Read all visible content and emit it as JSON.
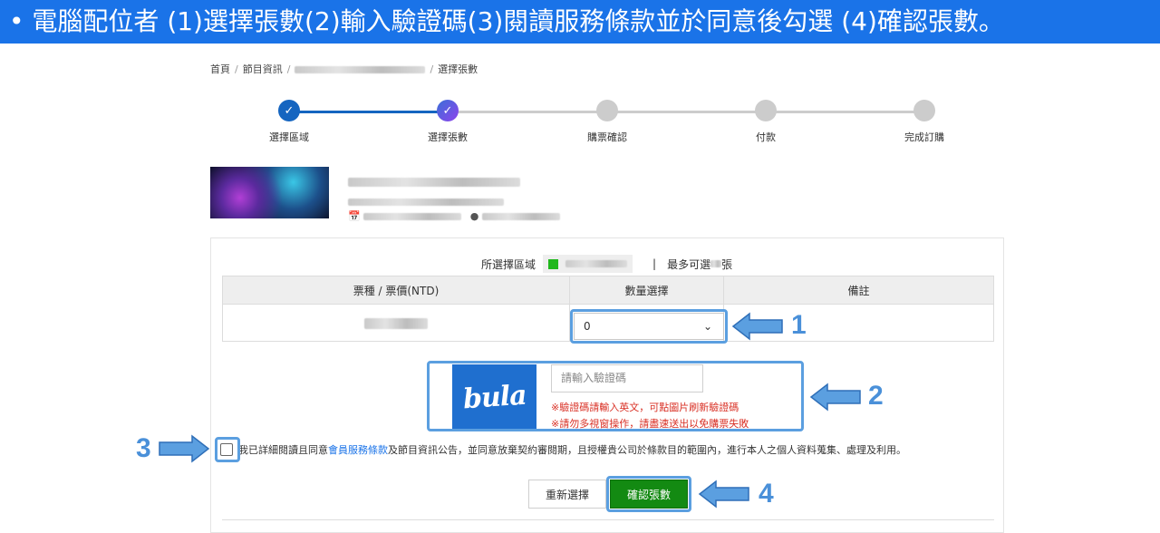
{
  "banner": {
    "text": "• 電腦配位者 (1)選擇張數(2)輸入驗證碼(3)閱讀服務條款並於同意後勾選 (4)確認張數。"
  },
  "breadcrumb": {
    "home": "首頁",
    "program": "節目資訊",
    "current": "選擇張數"
  },
  "steps": [
    {
      "label": "選擇區域",
      "state": "done"
    },
    {
      "label": "選擇張數",
      "state": "active"
    },
    {
      "label": "購票確認",
      "state": "pending"
    },
    {
      "label": "付款",
      "state": "pending"
    },
    {
      "label": "完成訂購",
      "state": "pending"
    }
  ],
  "selection": {
    "area_label": "所選擇區域",
    "separator": "|",
    "max_prefix": "最多可選",
    "max_suffix": "張"
  },
  "table": {
    "headers": [
      "票種 / 票價(NTD)",
      "數量選擇",
      "備註"
    ],
    "quantity_value": "0"
  },
  "captcha": {
    "image_text": "bula",
    "placeholder": "請輸入驗證碼",
    "warning1": "※驗證碼請輸入英文，可點圖片刷新驗證碼",
    "warning2": "※請勿多視窗操作，請盡速送出以免購票失敗"
  },
  "agreement": {
    "before": "我已詳細閱讀且同意",
    "link": "會員服務條款",
    "after": "及節目資訊公告，並同意放棄契約審閱期，且授權貴公司於條款目的範圍內，進行本人之個人資料蒐集、處理及利用。"
  },
  "buttons": {
    "reset": "重新選擇",
    "confirm": "確認張數"
  },
  "markers": {
    "n1": "1",
    "n2": "2",
    "n3": "3",
    "n4": "4"
  },
  "colors": {
    "banner": "#1a73e8",
    "step_done": "#1565c0",
    "step_pending": "#cccccc",
    "confirm": "#138a12",
    "highlight": "#5b9fe0",
    "warning": "#d93025"
  }
}
